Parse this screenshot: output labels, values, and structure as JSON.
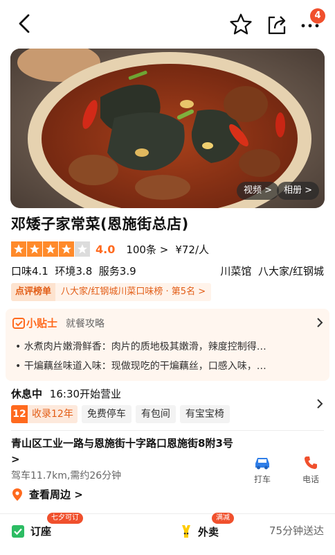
{
  "nav": {
    "badge_count": "4",
    "icons": [
      "back-arrow-icon",
      "star-icon",
      "share-icon",
      "more-dots-icon"
    ]
  },
  "photo": {
    "video_label": "视频 >",
    "album_label": "相册 >"
  },
  "shop": {
    "name": "邓矮子家常菜(恩施街总店)",
    "rating_value": 4.0,
    "score": "4.0",
    "reviews": "100条 >",
    "price": "¥72/人",
    "subscores": "口味4.1  环境3.8  服务3.9",
    "category": "川菜馆  八大家/红钢城"
  },
  "rank": {
    "tag": "点评榜单",
    "text": "八大家/红钢城川菜口味榜 · 第5名 >"
  },
  "tips": {
    "title": "小贴士",
    "subtitle": "就餐攻略",
    "items": [
      "• 水煮肉片嫩滑鲜香：肉片的质地极其嫩滑，辣度控制得…",
      "• 干煸藕丝味道入味：现做现吃的干煸藕丝，口感入味，…"
    ]
  },
  "hours": {
    "status": "休息中",
    "text": "16:30开始营业"
  },
  "badges": {
    "years_num": "12",
    "years_text": "收录12年",
    "chips": [
      "免费停车",
      "有包间",
      "有宝宝椅"
    ]
  },
  "address": {
    "text": "青山区工业一路与恩施街十字路口恩施街8附3号 >",
    "drive": "驾车11.7km,需约26分钟",
    "nearby": "查看周边 >",
    "taxi": "打车",
    "phone": "电话"
  },
  "bottom": {
    "reserve": "订座",
    "reserve_tag": "七夕可订",
    "takeout": "外卖",
    "takeout_tag": "满减",
    "delivery": "75分钟送达"
  },
  "colors": {
    "accent_orange": "#ff6a1e",
    "badge_red": "#f0502d",
    "star_orange": "#ff8a2a",
    "reserve_green": "#2cbc63",
    "takeout_yellow": "#ffcc00",
    "phone_red": "#f0502d",
    "taxi_blue": "#2f7ee8"
  }
}
